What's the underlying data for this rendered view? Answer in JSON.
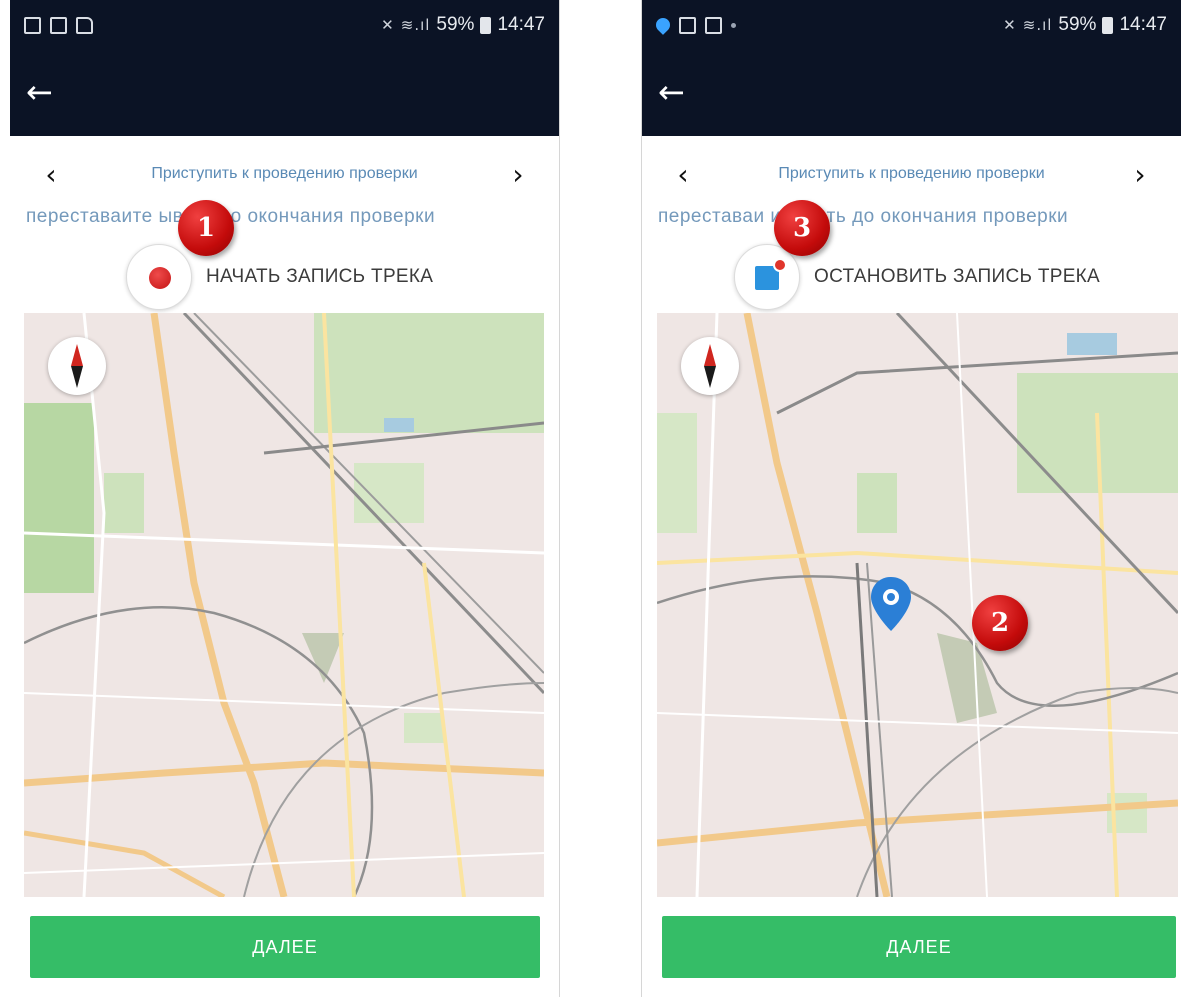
{
  "screens": [
    {
      "status_time": "14:47",
      "battery": "59%",
      "status_icons": [
        "image-icon",
        "calendar-icon",
        "doc-icon"
      ],
      "back_icon": "arrow-left-icon",
      "step_title": "Приступить к проведению проверки",
      "prev_icon": "chevron-left-icon",
      "next_icon": "chevron-right-icon",
      "scroll_text": "переставайте [записывать до окончания проверки]",
      "scroll_text_visible": "переставаите    ывать до окончания проверки",
      "record_label": "НАЧАТЬ ЗАПИСЬ ТРЕКА",
      "record_icon": "record-dot-icon",
      "callout": "1",
      "next_button": "ДАЛЕЕ"
    },
    {
      "status_time": "14:47",
      "battery": "59%",
      "status_icons": [
        "location-icon",
        "image-icon",
        "calendar-icon"
      ],
      "back_icon": "arrow-left-icon",
      "step_title": "Приступить к проведению проверки",
      "prev_icon": "chevron-left-icon",
      "next_icon": "chevron-right-icon",
      "scroll_text_visible": "переставаи     исывать до окончания проверки",
      "record_label": "ОСТАНОВИТЬ ЗАПИСЬ ТРЕКА",
      "record_icon": "stop-record-icon",
      "callout_stop": "3",
      "callout_map": "2",
      "next_button": "ДАЛЕЕ"
    }
  ],
  "colors": {
    "appbar": "#0b1325",
    "accent_green": "#35bd67",
    "link_blue": "#5a8ab5",
    "callout_red": "#c40b0b",
    "pin_blue": "#2b7fd6"
  }
}
